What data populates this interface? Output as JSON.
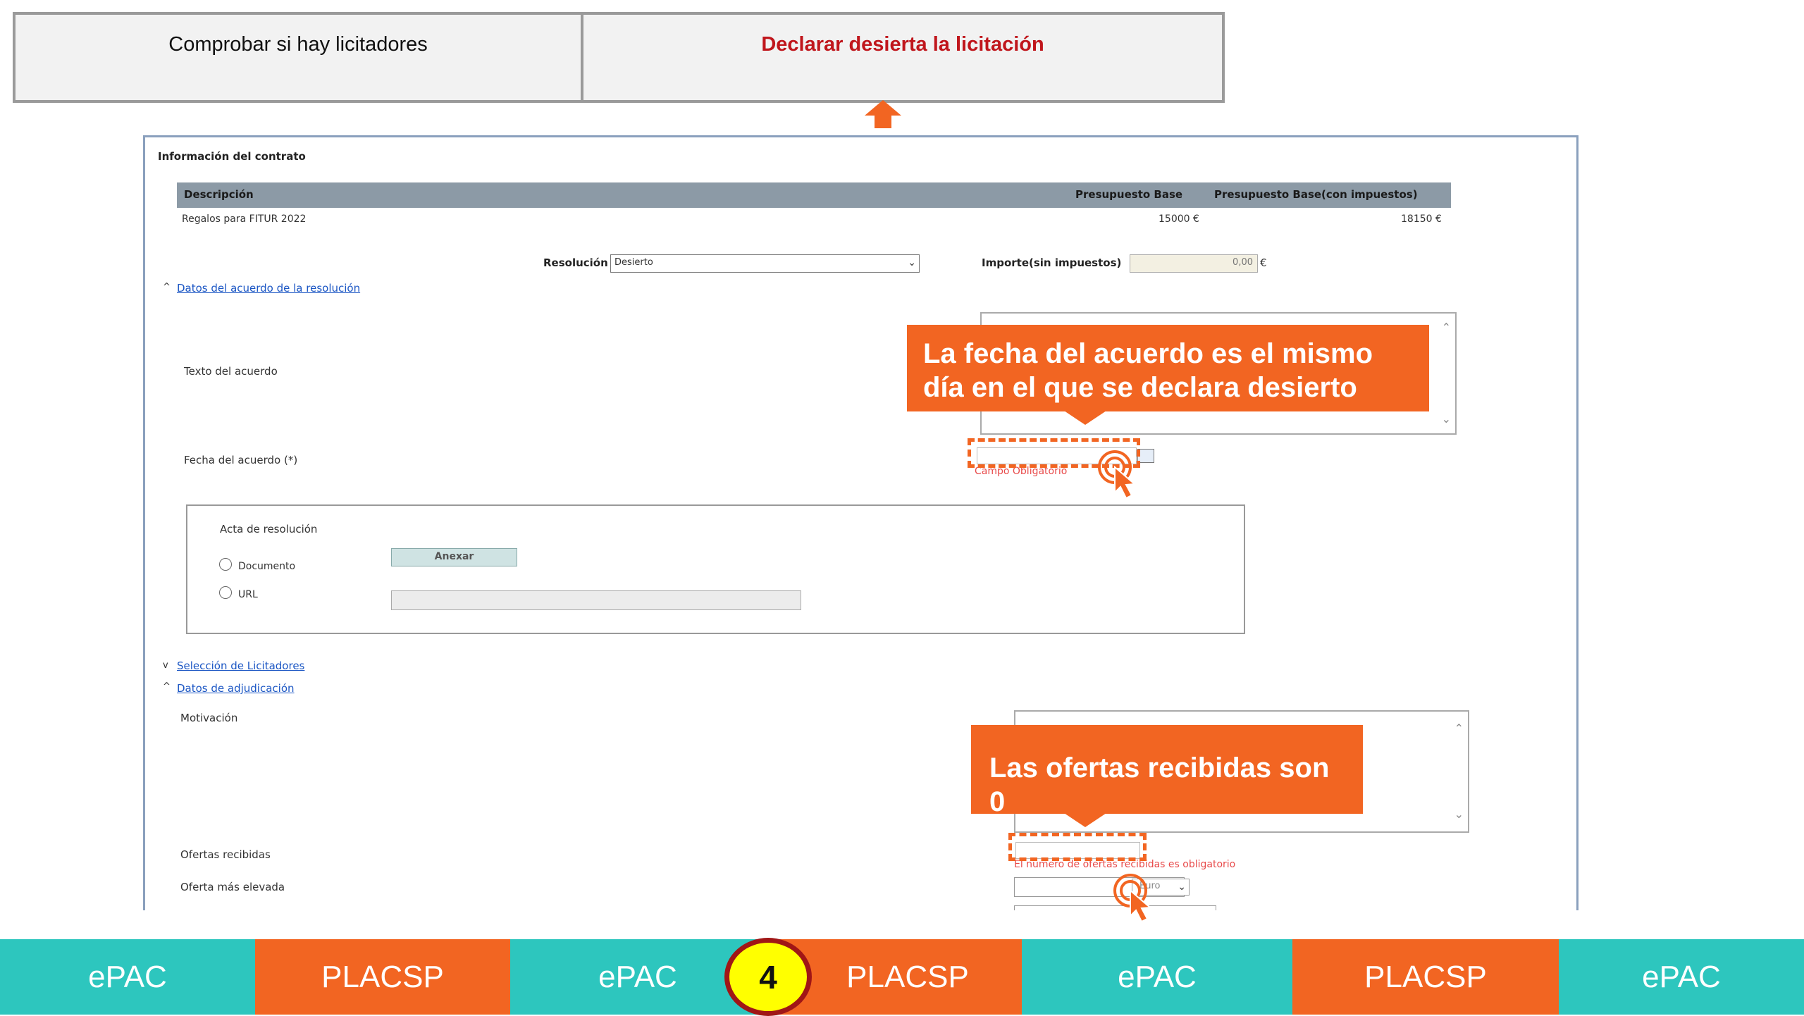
{
  "steps": {
    "check_bidders": "Comprobar si hay licitadores",
    "declare_void": "Declarar desierta la licitación"
  },
  "form": {
    "section_title": "Información del contrato",
    "table": {
      "headers": [
        "Descripción",
        "Presupuesto Base",
        "Presupuesto Base(con impuestos)"
      ],
      "row": [
        "Regalos para FITUR 2022",
        "15000 €",
        "18150 €"
      ]
    },
    "resolucion_label": "Resolución",
    "resolucion_value": "Desierto",
    "importe_label": "Importe(sin impuestos)",
    "importe_value": "0,00",
    "importe_unit": "€",
    "acuerdo_link": "Datos del acuerdo de la resolución",
    "texto_acuerdo_label": "Texto del acuerdo",
    "fecha_acuerdo_label": "Fecha del acuerdo (*)",
    "campo_obligatorio": "Campo Obligatorio",
    "acta_label": "Acta de resolución",
    "documento_label": "Documento",
    "url_label": "URL",
    "anexar_button": "Anexar",
    "seleccion_link": "Selección de Licitadores",
    "adjudicacion_link": "Datos de adjudicación",
    "motivacion_label": "Motivación",
    "ofertas_label": "Ofertas recibidas",
    "ofertas_error": "El número de ofertas recibidas es obligatorio",
    "oferta_elevada_label": "Oferta más elevada",
    "currency_value": "Euro"
  },
  "callouts": {
    "fecha": "La fecha del acuerdo es el mismo día en el que se declara desierto",
    "ofertas": "Las ofertas recibidas son 0"
  },
  "bottom_bar": {
    "items": [
      "ePAC",
      "PLACSP",
      "ePAC",
      "PLACSP",
      "ePAC",
      "PLACSP",
      "ePAC"
    ],
    "step_number": "4"
  },
  "colors": {
    "orange": "#f26522",
    "teal": "#2dc6be",
    "active_red": "#c0161c",
    "badge_yellow": "#ffff00"
  }
}
